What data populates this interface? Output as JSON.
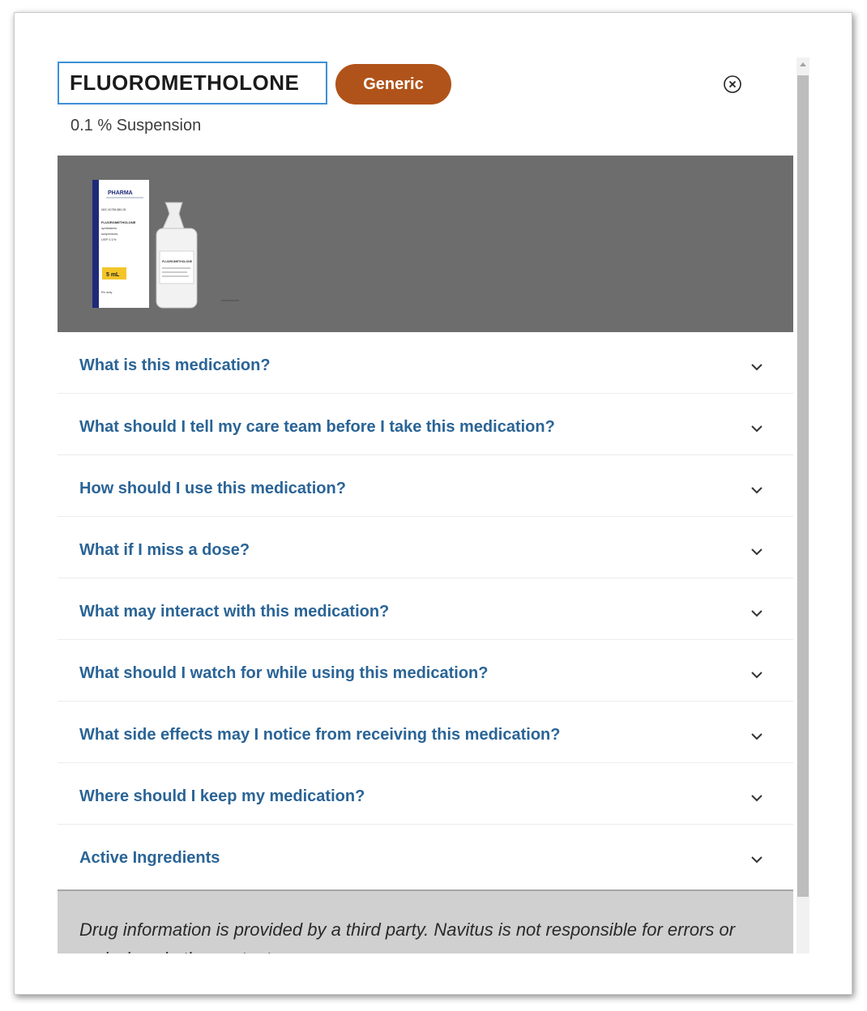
{
  "drug": {
    "name": "FLUOROMETHOLONE",
    "badge": "Generic",
    "strength": "0.1 % Suspension"
  },
  "image": {
    "box_brand": "PHARMA",
    "box_ndc": "NDC 60758-880-05",
    "box_lines": [
      "FLUOROMETHOLONE",
      "ophthalmic",
      "suspension,",
      "USP 0.1%"
    ],
    "box_volume": "5 mL",
    "box_rx": "Rx only",
    "bottle_label": "FLUOROMETHOLONE"
  },
  "accordion": [
    {
      "label": "What is this medication?"
    },
    {
      "label": "What should I tell my care team before I take this medication?"
    },
    {
      "label": "How should I use this medication?"
    },
    {
      "label": "What if I miss a dose?"
    },
    {
      "label": "What may interact with this medication?"
    },
    {
      "label": "What should I watch for while using this medication?"
    },
    {
      "label": "What side effects may I notice from receiving this medication?"
    },
    {
      "label": "Where should I keep my medication?"
    },
    {
      "label": "Active Ingredients"
    }
  ],
  "footer": {
    "disclaimer": "Drug information is provided by a third party. Navitus is not responsible for errors or omissions in the content."
  },
  "icons": {
    "close": "close-circle-icon",
    "chevron": "chevron-down-icon",
    "scroll_up": "scroll-up-arrow-icon"
  },
  "colors": {
    "badge": "#b0531a",
    "question": "#2a6496",
    "name_border": "#3e8fd6",
    "image_bg": "#6d6d6d",
    "footer_bg": "#d0d0d0"
  }
}
